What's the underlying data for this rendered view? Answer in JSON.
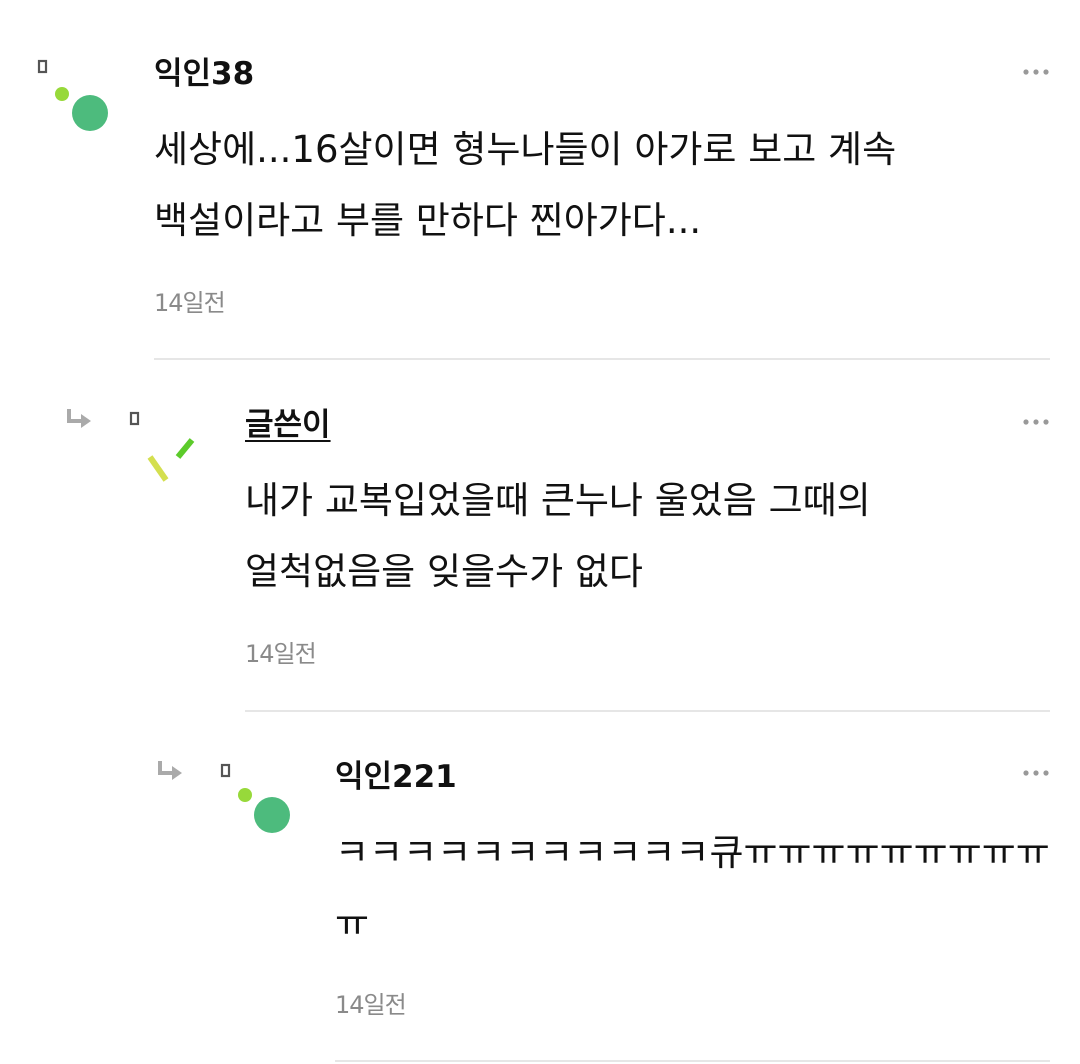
{
  "comments": [
    {
      "author": "익인38",
      "text": "세상에...16살이면 형누나들이 아가로 보고 계속 백설이라고 부를 만하다 찐아가다...",
      "time": "14일전",
      "icons": {
        "avatar": "green-dots-avatar-icon",
        "more": "more-options-icon"
      }
    },
    {
      "author": "글쓴이",
      "text": "내가 교복입었을때 큰누나 울었음 그때의 얼척없음을 잊을수가 없다",
      "time": "14일전",
      "icons": {
        "reply": "reply-arrow-icon",
        "avatar": "yellow-green-dashes-avatar-icon",
        "more": "more-options-icon"
      }
    },
    {
      "author": "익인221",
      "text": "ㅋㅋㅋㅋㅋㅋㅋㅋㅋㅋㅋ큐ㅠㅠㅠㅠㅠㅠㅠㅠㅠㅠ",
      "time": "14일전",
      "icons": {
        "reply": "reply-arrow-icon",
        "avatar": "green-dots-avatar-icon",
        "more": "more-options-icon"
      }
    }
  ],
  "colors": {
    "avatar_green": "#4dbb7d",
    "avatar_lime": "#97d93a",
    "avatar_yellow": "#d4df4f",
    "meta_gray": "#8a8a8a",
    "divider": "#e6e6e6"
  }
}
